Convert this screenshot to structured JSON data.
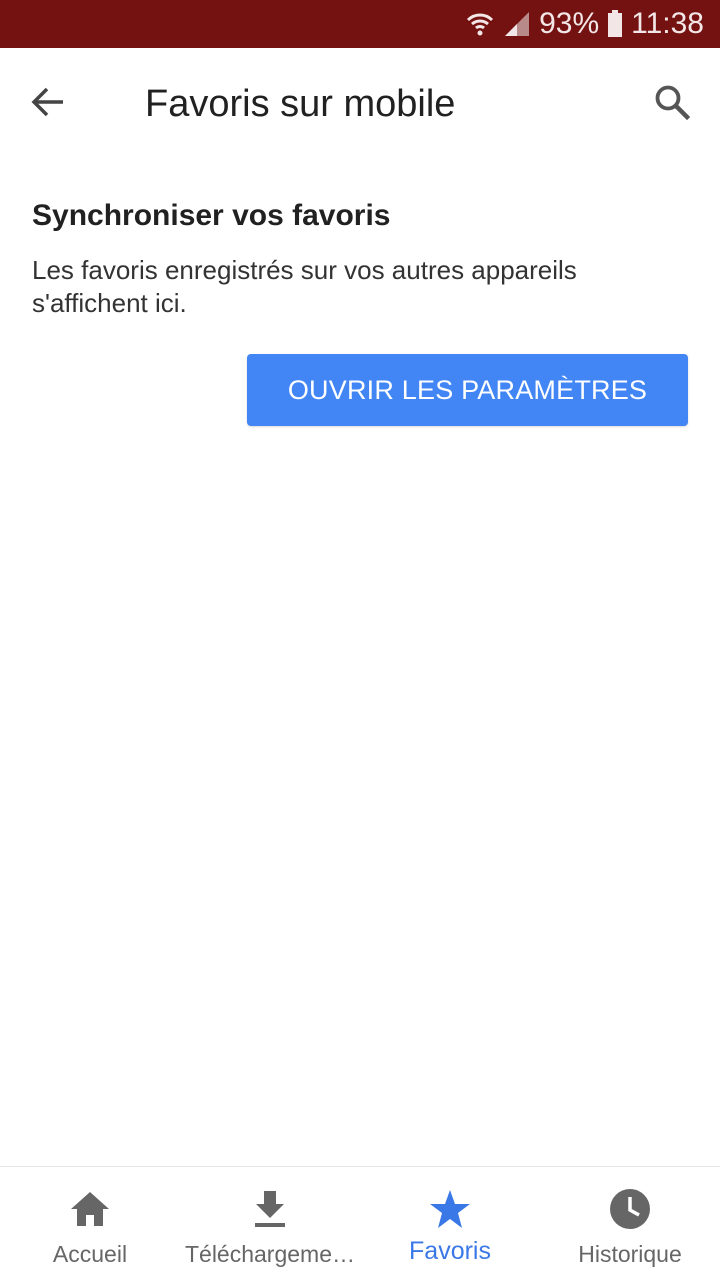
{
  "status_bar": {
    "battery": "93%",
    "time": "11:38",
    "wifi_icon": "wifi-icon",
    "signal_icon": "signal-icon",
    "battery_icon": "battery-icon"
  },
  "app_bar": {
    "title": "Favoris sur mobile",
    "back_icon": "arrow-back-icon",
    "search_icon": "search-icon"
  },
  "main": {
    "heading": "Synchroniser vos favoris",
    "description": "Les favoris enregistrés sur vos autres appareils s'affichent ici.",
    "button_label": "OUVRIR LES PARAMÈTRES"
  },
  "bottom_nav": {
    "items": [
      {
        "label": "Accueil",
        "icon": "home-icon"
      },
      {
        "label": "Téléchargeme…",
        "icon": "download-icon"
      },
      {
        "label": "Favoris",
        "icon": "star-icon",
        "active": true
      },
      {
        "label": "Historique",
        "icon": "clock-icon"
      }
    ]
  },
  "colors": {
    "status_bar": "#741111",
    "accent": "#4285f4",
    "active_tab": "#3b78e7"
  }
}
